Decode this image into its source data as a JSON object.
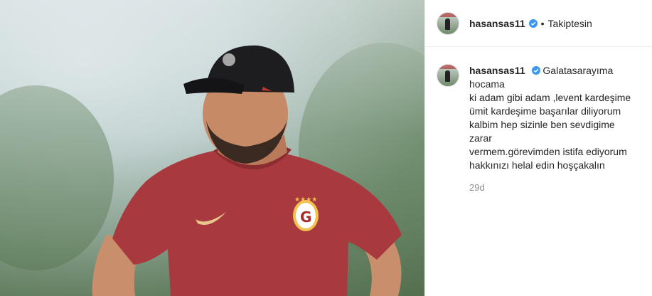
{
  "post": {
    "username": "hasansas11",
    "follow_status": "Takiptesin",
    "separator": "•",
    "caption": "Galatasarayıma hocama\nki adam gibi adam ,levent kardeşime\nümit kardeşime başarılar diliyorum\nkalbim hep sizinle ben sevdigime zarar\nvermem.görevimden istifa ediyorum\nhakkınızı helal edin hoşçakalın",
    "time_ago": "29d"
  },
  "colors": {
    "verified_blue": "#3897f0",
    "shirt_red": "#a83a3f",
    "cap_black": "#1d1d1f"
  },
  "icons": {
    "verified": "verified-badge-icon",
    "crest": "galatasaray-crest-icon",
    "swoosh": "nike-swoosh-icon"
  }
}
